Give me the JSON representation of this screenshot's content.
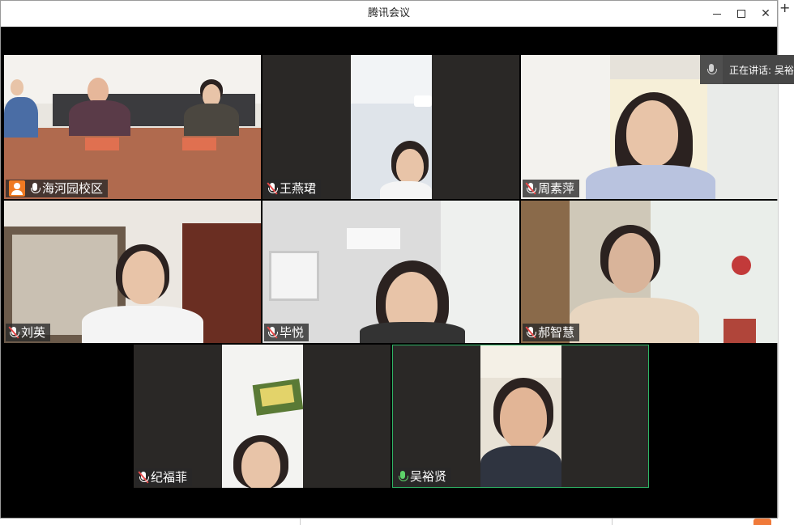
{
  "window": {
    "title": "腾讯会议"
  },
  "speaking": {
    "label": "正在讲话: 吴裕"
  },
  "participants": [
    {
      "name": "海河园校区",
      "mic": "on",
      "host": true
    },
    {
      "name": "王燕珺",
      "mic": "muted"
    },
    {
      "name": "周素萍",
      "mic": "muted"
    },
    {
      "name": "刘英",
      "mic": "muted"
    },
    {
      "name": "毕悦",
      "mic": "muted"
    },
    {
      "name": "郝智慧",
      "mic": "muted"
    },
    {
      "name": "纪福菲",
      "mic": "muted"
    },
    {
      "name": "吴裕贤",
      "mic": "active"
    }
  ],
  "colors": {
    "host_badge": "#f07a22",
    "active_speaker_border": "#2fb566",
    "muted_mic": "#e84a4a",
    "active_mic": "#5ed36a"
  }
}
